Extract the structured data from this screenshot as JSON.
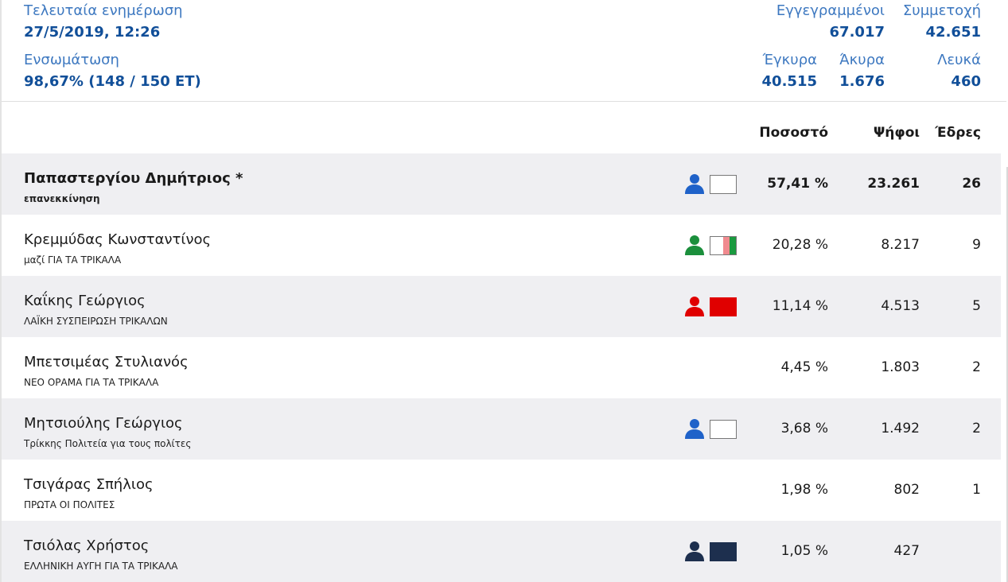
{
  "summary": {
    "last_update_label": "Τελευταία ενημέρωση",
    "last_update_value": "27/5/2019, 12:26",
    "integration_label": "Ενσωμάτωση",
    "integration_value": "98,67% (148 / 150 ΕΤ)",
    "registered_label": "Εγγεγραμμένοι",
    "registered_value": "67.017",
    "turnout_label": "Συμμετοχή",
    "turnout_value": "42.651",
    "valid_label": "Έγκυρα",
    "valid_value": "40.515",
    "invalid_label": "Άκυρα",
    "invalid_value": "1.676",
    "blank_label": "Λευκά",
    "blank_value": "460"
  },
  "columns": {
    "percent": "Ποσοστό",
    "votes": "Ψήφοι",
    "seats": "Έδρες"
  },
  "rows": [
    {
      "name": "Παπαστεργίου Δημήτριος *",
      "party": "επανεκκίνηση",
      "percent": "57,41 %",
      "votes": "23.261",
      "seats": "26",
      "person_icon_color": "#1f62c9",
      "flag": "white"
    },
    {
      "name": "Κρεμμύδας Κωνσταντίνος",
      "party": "μαζί ΓΙΑ ΤΑ ΤΡΙΚΑΛΑ",
      "percent": "20,28 %",
      "votes": "8.217",
      "seats": "9",
      "person_icon_color": "#1b8f3c",
      "flag": "white-pink-green"
    },
    {
      "name": "Καΐκης Γεώργιος",
      "party": "ΛΑΪΚΗ ΣΥΣΠΕΙΡΩΣΗ ΤΡΙΚΑΛΩΝ",
      "percent": "11,14 %",
      "votes": "4.513",
      "seats": "5",
      "person_icon_color": "#e00000",
      "flag": "red"
    },
    {
      "name": "Μπετσιμέας Στυλιανός",
      "party": "ΝΕΟ ΟΡΑΜΑ ΓΙΑ ΤΑ ΤΡΙΚΑΛΑ",
      "percent": "4,45 %",
      "votes": "1.803",
      "seats": "2"
    },
    {
      "name": "Μητσιούλης Γεώργιος",
      "party": "Τρίκκης Πολιτεία για τους πολίτες",
      "percent": "3,68 %",
      "votes": "1.492",
      "seats": "2",
      "person_icon_color": "#1f62c9",
      "flag": "white"
    },
    {
      "name": "Τσιγάρας Σπήλιος",
      "party": "ΠΡΩΤΑ ΟΙ ΠΟΛΙΤΕΣ",
      "percent": "1,98 %",
      "votes": "802",
      "seats": "1"
    },
    {
      "name": "Τσιόλας Χρήστος",
      "party": "ΕΛΛΗΝΙΚΗ ΑΥΓΗ ΓΙΑ ΤΑ ΤΡΙΚΑΛΑ",
      "percent": "1,05 %",
      "votes": "427",
      "seats": "",
      "person_icon_color": "#1d2f4e",
      "flag": "navy"
    }
  ]
}
